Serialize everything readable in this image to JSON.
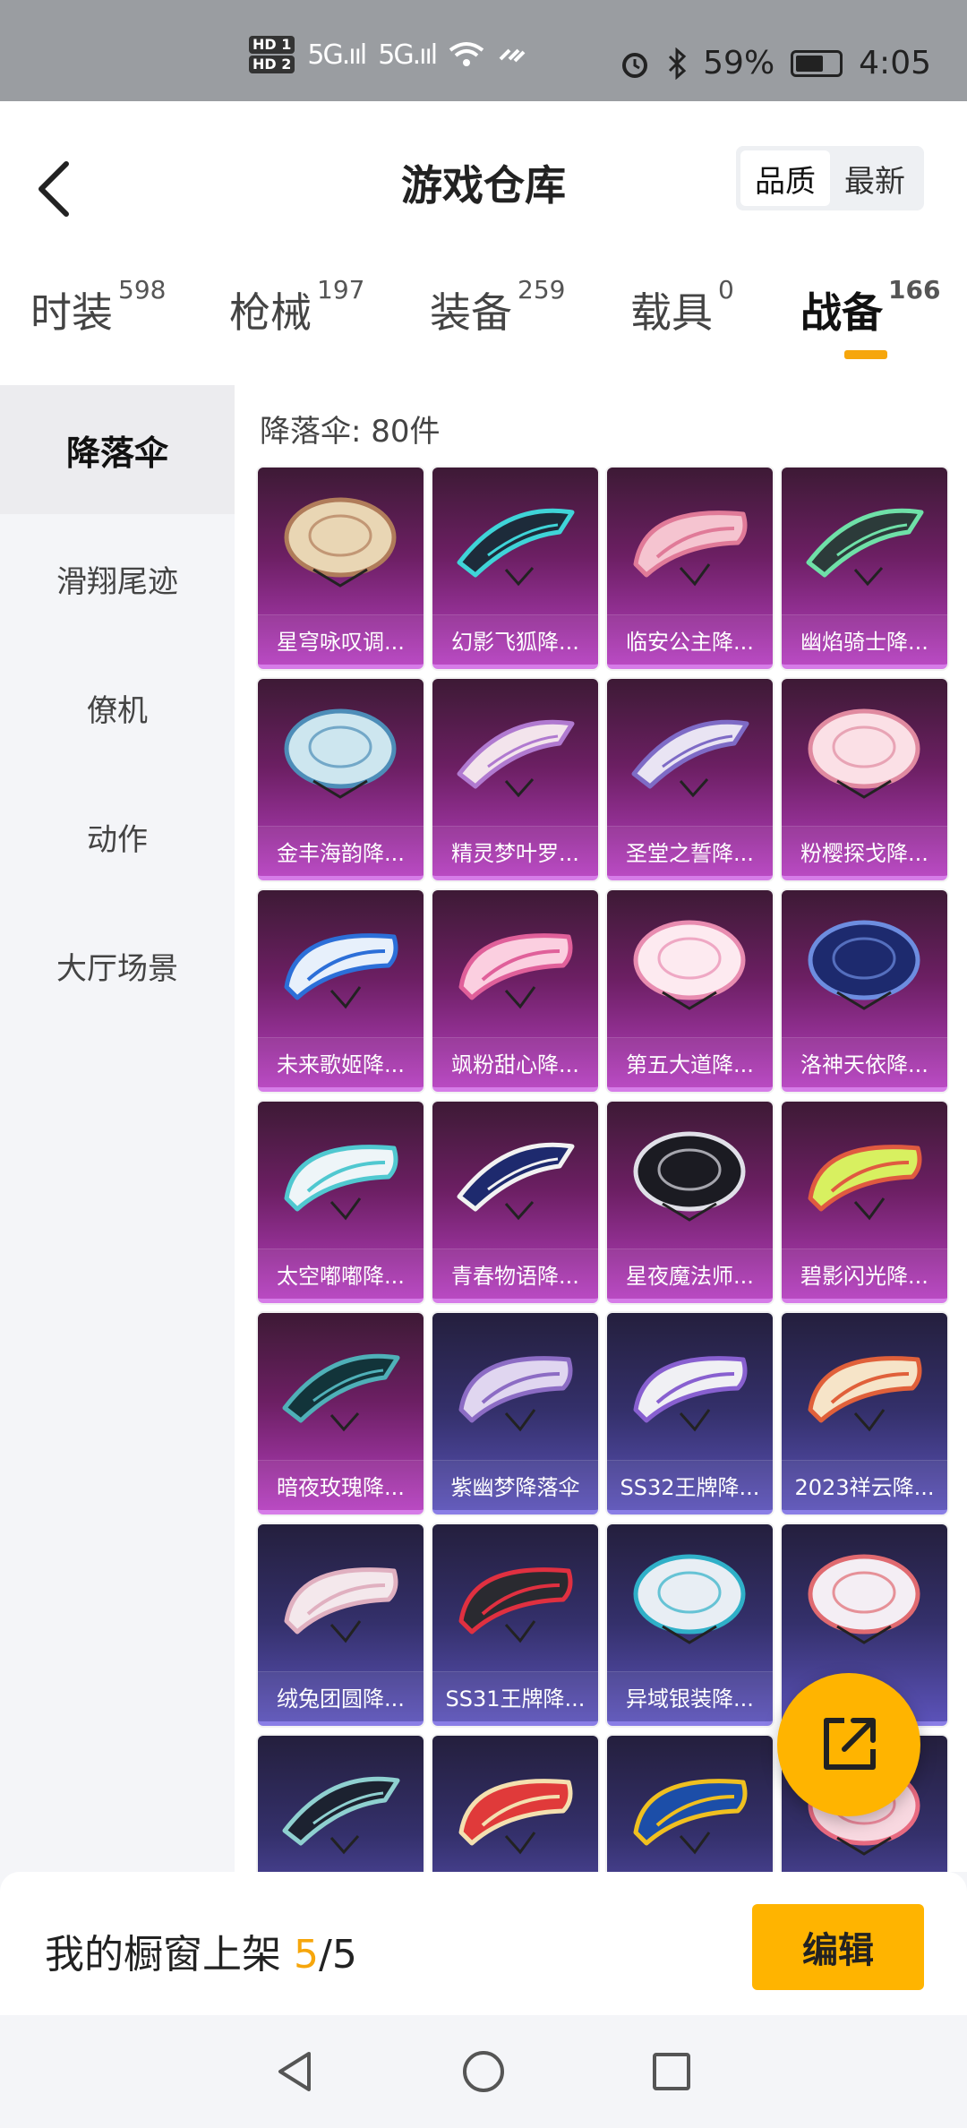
{
  "status_bar": {
    "hd_badges": [
      "HD 1",
      "HD 2"
    ],
    "signal_1": "5G.ııl",
    "signal_2": "5G.ııl",
    "battery_percent": "59%",
    "time": "4:05"
  },
  "header": {
    "title": "游戏仓库",
    "sort_options": [
      "品质",
      "最新"
    ],
    "active_sort": "品质"
  },
  "tabs": [
    {
      "label": "时装",
      "count": "598"
    },
    {
      "label": "枪械",
      "count": "197"
    },
    {
      "label": "装备",
      "count": "259"
    },
    {
      "label": "载具",
      "count": "0"
    },
    {
      "label": "战备",
      "count": "166"
    }
  ],
  "active_tab": "战备",
  "sidebar": {
    "items": [
      "降落伞",
      "滑翔尾迹",
      "僚机",
      "动作",
      "大厅场景"
    ],
    "active": "降落伞"
  },
  "content": {
    "count_label": "降落伞: 80件",
    "items": [
      {
        "name": "星穹咏叹调...",
        "tier": "pink",
        "colors": [
          "#e9d6b4",
          "#b07c5a"
        ],
        "shape": "round"
      },
      {
        "name": "幻影飞狐降...",
        "tier": "pink",
        "colors": [
          "#1d2b3a",
          "#3fd4d8"
        ],
        "shape": "wing"
      },
      {
        "name": "临安公主降...",
        "tier": "pink",
        "colors": [
          "#f5c4d0",
          "#e07a98"
        ],
        "shape": "flat"
      },
      {
        "name": "幽焰骑士降...",
        "tier": "pink",
        "colors": [
          "#2c3b3a",
          "#6fe0a8"
        ],
        "shape": "wing"
      },
      {
        "name": "金丰海韵降...",
        "tier": "pink",
        "colors": [
          "#cde6ef",
          "#4d8db8"
        ],
        "shape": "round"
      },
      {
        "name": "精灵梦叶罗...",
        "tier": "pink",
        "colors": [
          "#f3e4ec",
          "#b07ad0"
        ],
        "shape": "wing"
      },
      {
        "name": "圣堂之誓降...",
        "tier": "pink",
        "colors": [
          "#e9e4f3",
          "#7e6bc6"
        ],
        "shape": "wing"
      },
      {
        "name": "粉樱探戈降...",
        "tier": "pink",
        "colors": [
          "#fbe0e6",
          "#e08aa0"
        ],
        "shape": "round"
      },
      {
        "name": "未来歌姬降...",
        "tier": "pink",
        "colors": [
          "#e7f0fb",
          "#2c6fd8"
        ],
        "shape": "flat"
      },
      {
        "name": "飒粉甜心降...",
        "tier": "pink",
        "colors": [
          "#fbcfe0",
          "#e0609a"
        ],
        "shape": "flat"
      },
      {
        "name": "第五大道降...",
        "tier": "pink",
        "colors": [
          "#fdeaf0",
          "#e88cb0"
        ],
        "shape": "round"
      },
      {
        "name": "洛神天依降...",
        "tier": "pink",
        "colors": [
          "#1d2a6e",
          "#6d8de0"
        ],
        "shape": "round"
      },
      {
        "name": "太空嘟嘟降...",
        "tier": "pink",
        "colors": [
          "#eef5f8",
          "#50c8d0"
        ],
        "shape": "flat"
      },
      {
        "name": "青春物语降...",
        "tier": "pink",
        "colors": [
          "#1e2a6e",
          "#f2f2f2"
        ],
        "shape": "wing"
      },
      {
        "name": "星夜魔法师...",
        "tier": "pink",
        "colors": [
          "#1b1b22",
          "#e0e0e8"
        ],
        "shape": "round"
      },
      {
        "name": "碧影闪光降...",
        "tier": "pink",
        "colors": [
          "#d8f060",
          "#e05a40"
        ],
        "shape": "flat"
      },
      {
        "name": "暗夜玫瑰降...",
        "tier": "pink",
        "colors": [
          "#12343a",
          "#4fb0b8"
        ],
        "shape": "wing"
      },
      {
        "name": "紫幽梦降落伞",
        "tier": "blue",
        "colors": [
          "#e0d6f0",
          "#8c6cc4"
        ],
        "shape": "flat"
      },
      {
        "name": "SS32王牌降...",
        "tier": "blue",
        "colors": [
          "#f0f0f4",
          "#8860d0"
        ],
        "shape": "flat"
      },
      {
        "name": "2023祥云降...",
        "tier": "blue",
        "colors": [
          "#f6e4c8",
          "#e0603a"
        ],
        "shape": "flat"
      },
      {
        "name": "绒兔团圆降...",
        "tier": "blue",
        "colors": [
          "#f4e8ec",
          "#e0b0c0"
        ],
        "shape": "flat"
      },
      {
        "name": "SS31王牌降...",
        "tier": "blue",
        "colors": [
          "#2a2a30",
          "#e03040"
        ],
        "shape": "flat"
      },
      {
        "name": "异域银装降...",
        "tier": "blue",
        "colors": [
          "#e8eef4",
          "#2fb0c8"
        ],
        "shape": "round"
      },
      {
        "name": "",
        "tier": "blue",
        "colors": [
          "#f4eef4",
          "#e06a70"
        ],
        "shape": "round"
      },
      {
        "name": "",
        "tier": "blue",
        "colors": [
          "#1c2230",
          "#8fd0d0"
        ],
        "shape": "wing"
      },
      {
        "name": "",
        "tier": "blue",
        "colors": [
          "#e03a3a",
          "#f4e0b0"
        ],
        "shape": "flat"
      },
      {
        "name": "",
        "tier": "blue",
        "colors": [
          "#1c4ea8",
          "#f0c020"
        ],
        "shape": "flat"
      },
      {
        "name": "",
        "tier": "blue",
        "colors": [
          "#f8d8e0",
          "#e86a80"
        ],
        "shape": "round"
      }
    ]
  },
  "bottom_bar": {
    "showcase_label": "我的橱窗上架",
    "showcase_current": "5",
    "showcase_total": "/5",
    "edit_label": "编辑"
  },
  "colors": {
    "accent": "#f6a60c",
    "button": "#ffb400"
  }
}
